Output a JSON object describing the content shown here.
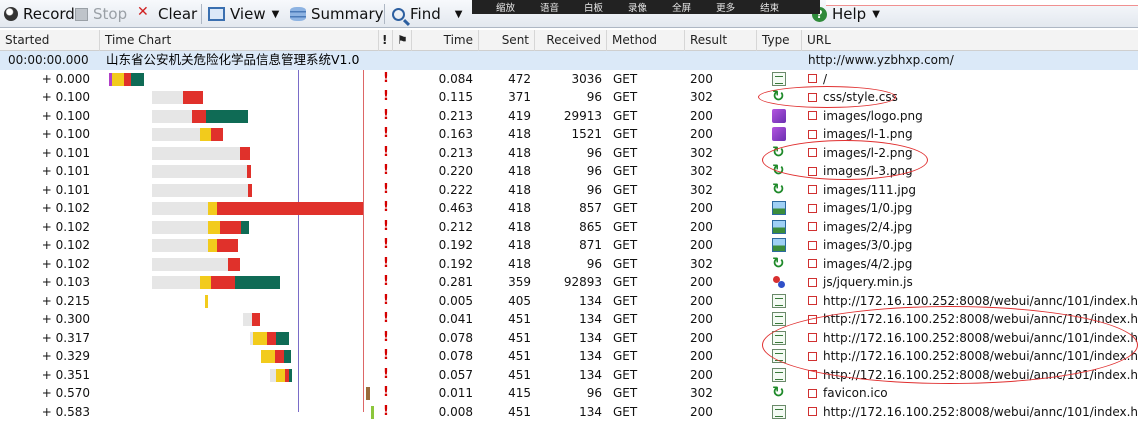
{
  "toolbar": {
    "record": "Record",
    "stop": "Stop",
    "clear": "Clear",
    "view": "View",
    "summary": "Summary",
    "find": "Find",
    "help": "Help"
  },
  "overlay": [
    "缩放",
    "语音",
    "白板",
    "录像",
    "全屏",
    "更多",
    "结束"
  ],
  "columns": {
    "started": "Started",
    "time_chart": "Time Chart",
    "bang": "!",
    "time": "Time",
    "sent": "Sent",
    "received": "Received",
    "method": "Method",
    "result": "Result",
    "type": "Type",
    "url": "URL"
  },
  "page_row": {
    "started": "00:00:00.000",
    "title": "山东省公安机关危险化学品信息管理系统V1.0",
    "url": "http://www.yzbhxp.com/"
  },
  "rows": [
    {
      "started": "+ 0.000",
      "time": "0.084",
      "sent": "472",
      "received": "3036",
      "method": "GET",
      "result": "200",
      "type": "html",
      "url": "/"
    },
    {
      "started": "+ 0.100",
      "time": "0.115",
      "sent": "371",
      "received": "96",
      "method": "GET",
      "result": "302",
      "type": "redirect",
      "url": "css/style.css"
    },
    {
      "started": "+ 0.100",
      "time": "0.213",
      "sent": "419",
      "received": "29913",
      "method": "GET",
      "result": "200",
      "type": "png",
      "url": "images/logo.png"
    },
    {
      "started": "+ 0.100",
      "time": "0.163",
      "sent": "418",
      "received": "1521",
      "method": "GET",
      "result": "200",
      "type": "png",
      "url": "images/l-1.png"
    },
    {
      "started": "+ 0.101",
      "time": "0.213",
      "sent": "418",
      "received": "96",
      "method": "GET",
      "result": "302",
      "type": "redirect",
      "url": "images/l-2.png"
    },
    {
      "started": "+ 0.101",
      "time": "0.220",
      "sent": "418",
      "received": "96",
      "method": "GET",
      "result": "302",
      "type": "redirect",
      "url": "images/l-3.png"
    },
    {
      "started": "+ 0.101",
      "time": "0.222",
      "sent": "418",
      "received": "96",
      "method": "GET",
      "result": "302",
      "type": "redirect",
      "url": "images/111.jpg"
    },
    {
      "started": "+ 0.102",
      "time": "0.463",
      "sent": "418",
      "received": "857",
      "method": "GET",
      "result": "200",
      "type": "jpg",
      "url": "images/1/0.jpg"
    },
    {
      "started": "+ 0.102",
      "time": "0.212",
      "sent": "418",
      "received": "865",
      "method": "GET",
      "result": "200",
      "type": "jpg",
      "url": "images/2/4.jpg"
    },
    {
      "started": "+ 0.102",
      "time": "0.192",
      "sent": "418",
      "received": "871",
      "method": "GET",
      "result": "200",
      "type": "jpg",
      "url": "images/3/0.jpg"
    },
    {
      "started": "+ 0.102",
      "time": "0.192",
      "sent": "418",
      "received": "96",
      "method": "GET",
      "result": "302",
      "type": "redirect",
      "url": "images/4/2.jpg"
    },
    {
      "started": "+ 0.103",
      "time": "0.281",
      "sent": "359",
      "received": "92893",
      "method": "GET",
      "result": "200",
      "type": "js",
      "url": "js/jquery.min.js"
    },
    {
      "started": "+ 0.215",
      "time": "0.005",
      "sent": "405",
      "received": "134",
      "method": "GET",
      "result": "200",
      "type": "html",
      "url": "http://172.16.100.252:8008/webui/annc/101/index.htm"
    },
    {
      "started": "+ 0.300",
      "time": "0.041",
      "sent": "451",
      "received": "134",
      "method": "GET",
      "result": "200",
      "type": "html",
      "url": "http://172.16.100.252:8008/webui/annc/101/index.htm"
    },
    {
      "started": "+ 0.317",
      "time": "0.078",
      "sent": "451",
      "received": "134",
      "method": "GET",
      "result": "200",
      "type": "html",
      "url": "http://172.16.100.252:8008/webui/annc/101/index.htm"
    },
    {
      "started": "+ 0.329",
      "time": "0.078",
      "sent": "451",
      "received": "134",
      "method": "GET",
      "result": "200",
      "type": "html",
      "url": "http://172.16.100.252:8008/webui/annc/101/index.htm"
    },
    {
      "started": "+ 0.351",
      "time": "0.057",
      "sent": "451",
      "received": "134",
      "method": "GET",
      "result": "200",
      "type": "html",
      "url": "http://172.16.100.252:8008/webui/annc/101/index.htm"
    },
    {
      "started": "+ 0.570",
      "time": "0.011",
      "sent": "415",
      "received": "96",
      "method": "GET",
      "result": "302",
      "type": "redirect",
      "url": "favicon.ico"
    },
    {
      "started": "+ 0.583",
      "time": "0.008",
      "sent": "451",
      "received": "134",
      "method": "GET",
      "result": "200",
      "type": "html",
      "url": "http://172.16.100.252:8008/webui/annc/101/index.htm"
    }
  ],
  "colors": {
    "accent_select": "#dbe9f8",
    "flag_red": "#d40000",
    "bar_grey": "#e6e6e6",
    "bar_yellow": "#f2cb1c",
    "bar_red": "#e0312b",
    "bar_teal": "#0f6b55",
    "annotation_red": "#e03030"
  }
}
